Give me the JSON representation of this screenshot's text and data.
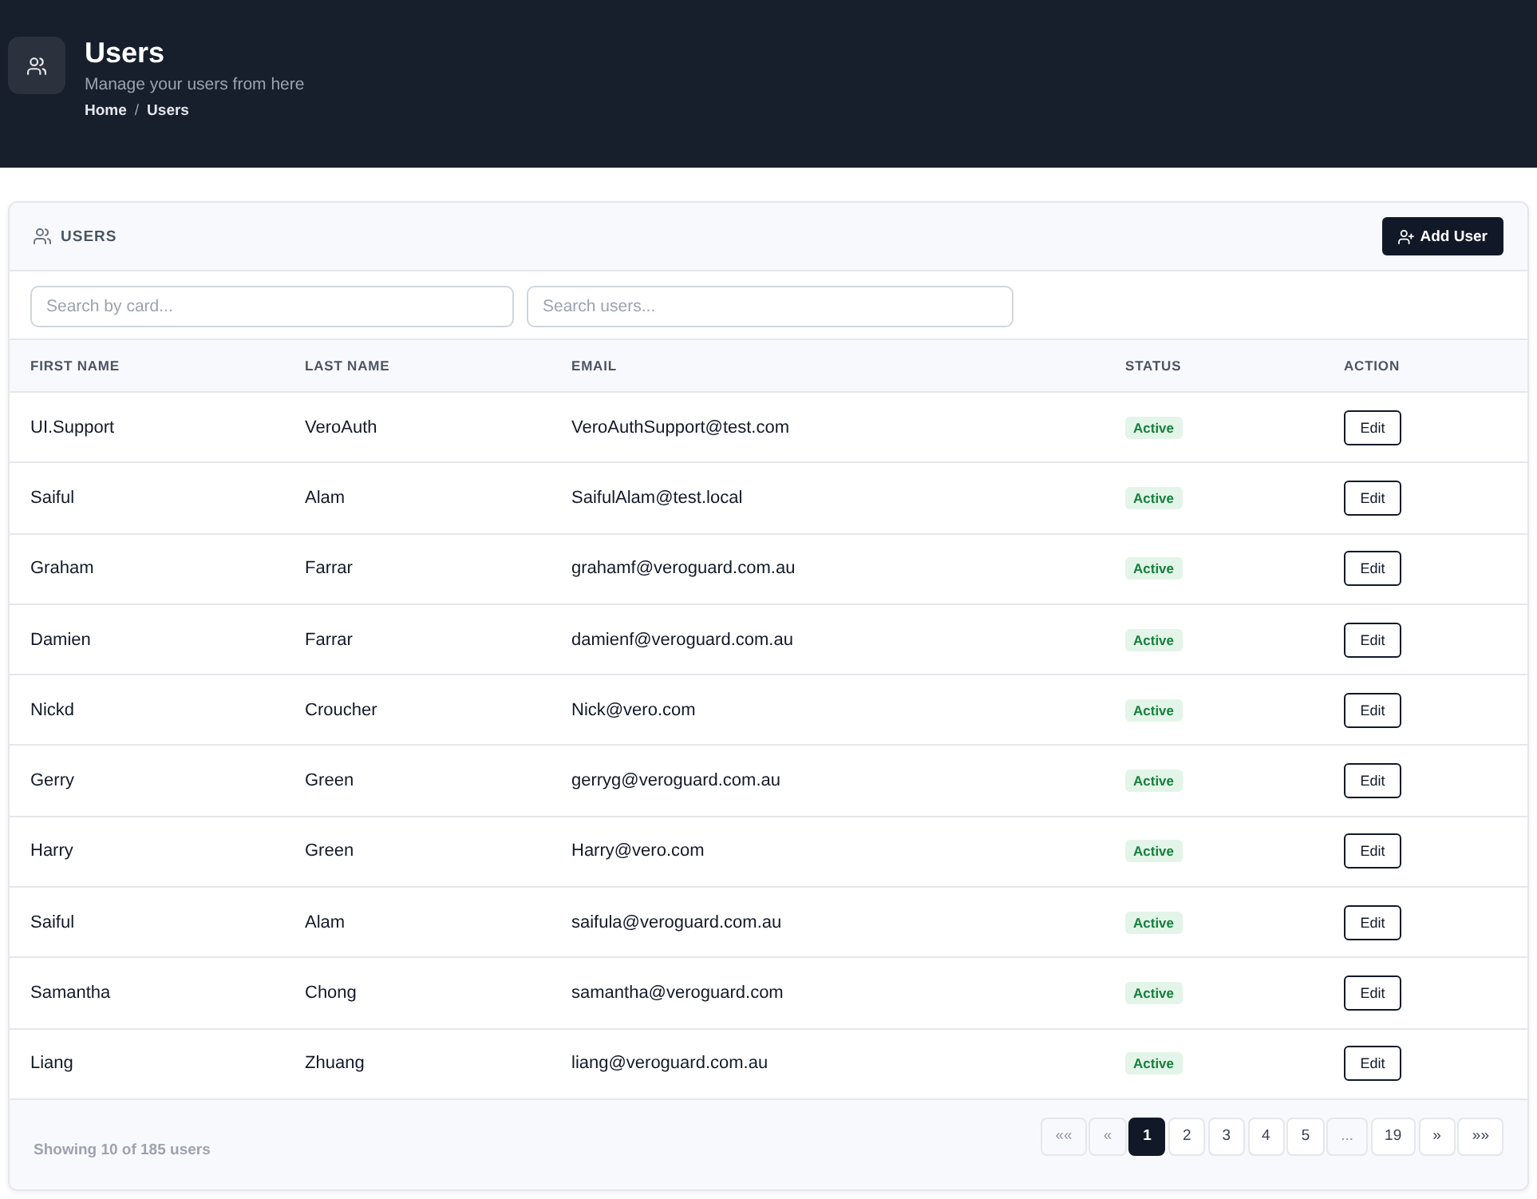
{
  "header": {
    "title": "Users",
    "subtitle": "Manage your users from here",
    "breadcrumb": {
      "items": [
        "Home",
        "Users"
      ],
      "separator": "/"
    }
  },
  "card": {
    "title": "USERS",
    "add_button": "Add User"
  },
  "filters": [
    {
      "placeholder": "Search by card..."
    },
    {
      "placeholder": "Search users..."
    }
  ],
  "table": {
    "columns": [
      "FIRST NAME",
      "LAST NAME",
      "EMAIL",
      "STATUS",
      "ACTION"
    ],
    "rows": [
      {
        "first_name": "UI.Support",
        "last_name": "VeroAuth",
        "email": "VeroAuthSupport@test.com",
        "status": "Active",
        "action": "Edit"
      },
      {
        "first_name": "Saiful",
        "last_name": "Alam",
        "email": "SaifulAlam@test.local",
        "status": "Active",
        "action": "Edit"
      },
      {
        "first_name": "Graham",
        "last_name": "Farrar",
        "email": "grahamf@veroguard.com.au",
        "status": "Active",
        "action": "Edit"
      },
      {
        "first_name": "Damien",
        "last_name": "Farrar",
        "email": "damienf@veroguard.com.au",
        "status": "Active",
        "action": "Edit"
      },
      {
        "first_name": "Nickd",
        "last_name": "Croucher",
        "email": "Nick@vero.com",
        "status": "Active",
        "action": "Edit"
      },
      {
        "first_name": "Gerry",
        "last_name": "Green",
        "email": "gerryg@veroguard.com.au",
        "status": "Active",
        "action": "Edit"
      },
      {
        "first_name": "Harry",
        "last_name": "Green",
        "email": "Harry@vero.com",
        "status": "Active",
        "action": "Edit"
      },
      {
        "first_name": "Saiful",
        "last_name": "Alam",
        "email": "saifula@veroguard.com.au",
        "status": "Active",
        "action": "Edit"
      },
      {
        "first_name": "Samantha",
        "last_name": "Chong",
        "email": "samantha@veroguard.com",
        "status": "Active",
        "action": "Edit"
      },
      {
        "first_name": "Liang",
        "last_name": "Zhuang",
        "email": "liang@veroguard.com.au",
        "status": "Active",
        "action": "Edit"
      }
    ]
  },
  "pagination": {
    "summary": "Showing 10 of 185 users",
    "pages": [
      {
        "label": "««",
        "selected": false,
        "disabled": true
      },
      {
        "label": "«",
        "selected": false,
        "disabled": true
      },
      {
        "label": "1",
        "selected": true,
        "disabled": false
      },
      {
        "label": "2",
        "selected": false,
        "disabled": false
      },
      {
        "label": "3",
        "selected": false,
        "disabled": false
      },
      {
        "label": "4",
        "selected": false,
        "disabled": false
      },
      {
        "label": "5",
        "selected": false,
        "disabled": false
      },
      {
        "label": "...",
        "selected": false,
        "disabled": true
      },
      {
        "label": "19",
        "selected": false,
        "disabled": false
      },
      {
        "label": "»",
        "selected": false,
        "disabled": false
      },
      {
        "label": "»»",
        "selected": false,
        "disabled": false
      }
    ]
  }
}
